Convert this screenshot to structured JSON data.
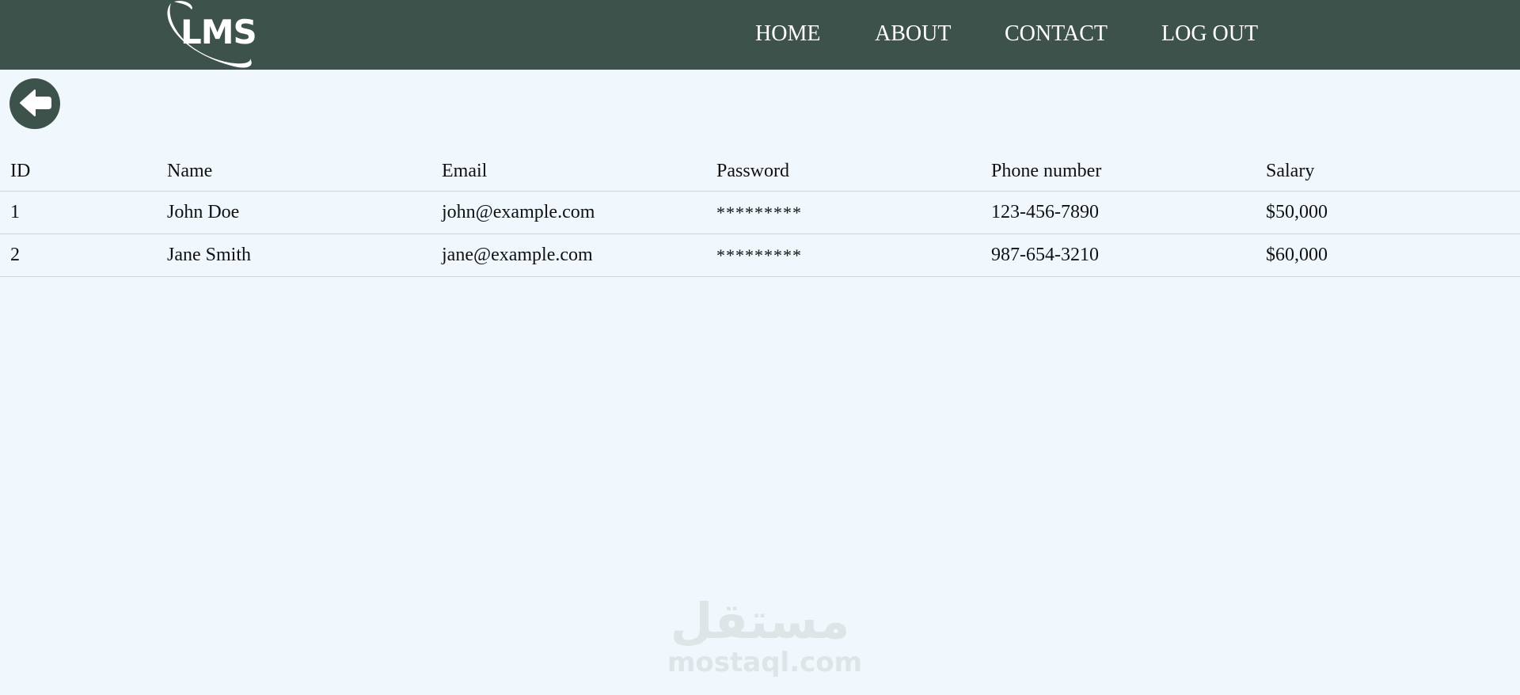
{
  "header": {
    "logo_text": "LMS",
    "nav": [
      {
        "label": "HOME"
      },
      {
        "label": "ABOUT"
      },
      {
        "label": "CONTACT"
      },
      {
        "label": "LOG OUT"
      }
    ]
  },
  "icons": {
    "back": "arrow-left-circle-icon"
  },
  "colors": {
    "navbar_bg": "#3d524a",
    "page_bg": "#f0f8fd",
    "nav_text": "#ffffff"
  },
  "table": {
    "columns": [
      "ID",
      "Name",
      "Email",
      "Password",
      "Phone number",
      "Salary"
    ],
    "rows": [
      [
        "1",
        "John Doe",
        "john@example.com",
        "*********",
        "123-456-7890",
        "$50,000"
      ],
      [
        "2",
        "Jane Smith",
        "jane@example.com",
        "*********",
        "987-654-3210",
        "$60,000"
      ]
    ]
  },
  "watermark": {
    "arabic": "مستقل",
    "latin": "mostaql.com"
  }
}
